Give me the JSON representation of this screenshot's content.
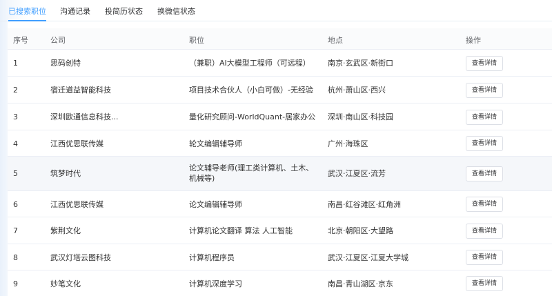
{
  "tabs": [
    {
      "label": "已搜索职位",
      "active": true
    },
    {
      "label": "沟通记录",
      "active": false
    },
    {
      "label": "投简历状态",
      "active": false
    },
    {
      "label": "换微信状态",
      "active": false
    }
  ],
  "table": {
    "headers": {
      "index": "序号",
      "company": "公司",
      "position": "职位",
      "location": "地点",
      "action": "操作"
    },
    "rows": [
      {
        "index": "1",
        "company": "思码创特",
        "position": "（兼职）AI大模型工程师（可远程）",
        "location": "南京·玄武区·新街口",
        "action": "查看详情"
      },
      {
        "index": "2",
        "company": "宿迁道益智能科技",
        "position": "项目技术合伙人（小白可做）-无经验",
        "location": "杭州·萧山区·西兴",
        "action": "查看详情"
      },
      {
        "index": "3",
        "company": "深圳欧通信息科技...",
        "position": "量化研究顾问-WorldQuant-居家办公",
        "location": "深圳·南山区·科技园",
        "action": "查看详情"
      },
      {
        "index": "4",
        "company": "江西优思联传媒",
        "position": "轮文编辑辅导师",
        "location": "广州·海珠区",
        "action": "查看详情"
      },
      {
        "index": "5",
        "company": "筑梦时代",
        "position": "论文辅导老师(理工类计算机、土木、机械等)",
        "location": "武汉·江夏区·流芳",
        "action": "查看详情"
      },
      {
        "index": "6",
        "company": "江西优思联传媒",
        "position": "论文编辑辅导师",
        "location": "南昌·红谷滩区·红角洲",
        "action": "查看详情"
      },
      {
        "index": "7",
        "company": "紫荆文化",
        "position": "计算机论文翻译 算法 人工智能",
        "location": "北京·朝阳区·大望路",
        "action": "查看详情"
      },
      {
        "index": "8",
        "company": "武汉灯塔云图科技",
        "position": "计算机程序员",
        "location": "武汉·江夏区·江夏大学城",
        "action": "查看详情"
      },
      {
        "index": "9",
        "company": "妙笔文化",
        "position": "计算机深度学习",
        "location": "南昌·青山湖区·京东",
        "action": "查看详情"
      }
    ]
  }
}
